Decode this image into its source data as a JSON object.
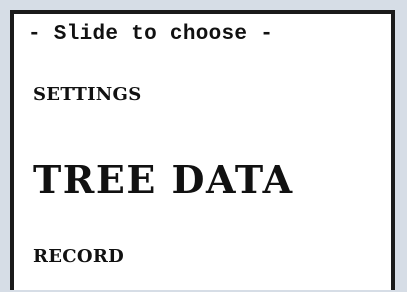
{
  "screen": {
    "hint": "- Slide to choose -",
    "menu": {
      "items": [
        {
          "label": "SETTINGS",
          "selected": false
        },
        {
          "label": "TREE DATA",
          "selected": true
        },
        {
          "label": "RECORD",
          "selected": false
        }
      ]
    }
  },
  "colors": {
    "background": "#d6dde6",
    "screen": "#ffffff",
    "text": "#111111",
    "border": "#1a1a1a"
  }
}
